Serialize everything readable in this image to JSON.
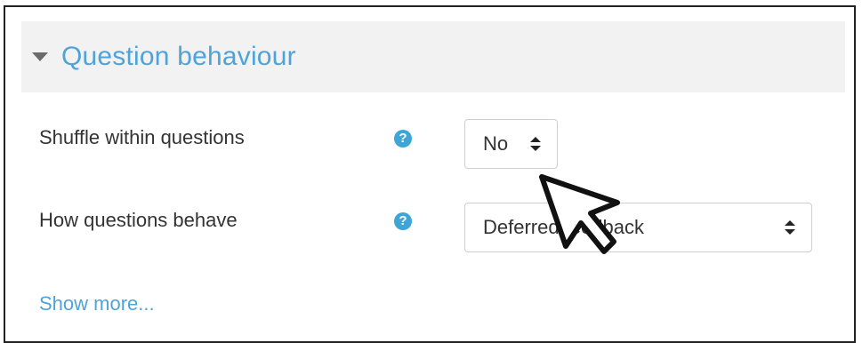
{
  "section": {
    "title": "Question behaviour",
    "collapse_icon": "chevron-down-icon"
  },
  "rows": [
    {
      "label": "Shuffle within questions",
      "help_icon": "question-circle-icon",
      "help_glyph": "?",
      "selected": "No"
    },
    {
      "label": "How questions behave",
      "help_icon": "question-circle-icon",
      "help_glyph": "?",
      "selected": "Deferred feedback"
    }
  ],
  "show_more": "Show more...",
  "colors": {
    "accent": "#4fa3d9",
    "help_icon": "#3ea6d6",
    "header_bg": "#f2f2f2",
    "text": "#333333"
  },
  "cursor_icon": "mouse-pointer-icon"
}
